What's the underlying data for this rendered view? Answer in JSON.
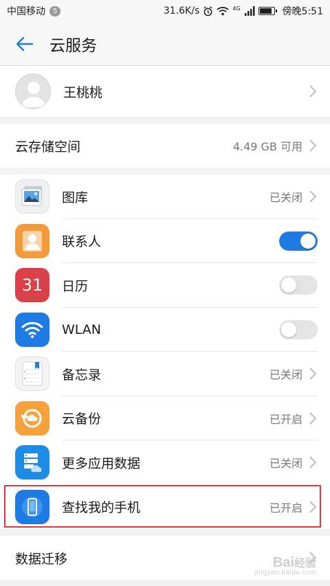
{
  "status_bar": {
    "carrier": "中国移动",
    "sim_badge": "5",
    "speed": "31.6K/s",
    "network": "4G",
    "time": "傍晚5:51"
  },
  "app_bar": {
    "title": "云服务",
    "back_icon": "arrow-left-icon"
  },
  "account": {
    "name": "王桃桃",
    "avatar_icon": "default-avatar-icon"
  },
  "storage": {
    "label": "云存储空间",
    "value": "4.49 GB 可用"
  },
  "apps": [
    {
      "label": "图库",
      "state_text": "已关闭",
      "control": "chevron",
      "icon": "gallery-icon"
    },
    {
      "label": "联系人",
      "control": "toggle",
      "toggle_on": true,
      "icon": "contacts-icon"
    },
    {
      "label": "日历",
      "control": "toggle",
      "toggle_on": false,
      "icon": "calendar-icon",
      "icon_text": "31"
    },
    {
      "label": "WLAN",
      "control": "toggle",
      "toggle_on": false,
      "icon": "wlan-icon"
    },
    {
      "label": "备忘录",
      "state_text": "已关闭",
      "control": "chevron",
      "icon": "notepad-icon"
    },
    {
      "label": "云备份",
      "state_text": "已开启",
      "control": "chevron",
      "icon": "cloud-backup-icon"
    },
    {
      "label": "更多应用数据",
      "state_text": "已关闭",
      "control": "chevron",
      "icon": "more-app-data-icon"
    },
    {
      "label": "查找我的手机",
      "state_text": "已开启",
      "control": "chevron",
      "icon": "find-phone-icon"
    }
  ],
  "migrate": {
    "label": "数据迁移"
  },
  "colors": {
    "accent": "#1e7be4",
    "highlight": "#e0343f",
    "calendar": "#d8404a",
    "contacts": "#f39a3c",
    "wlan": "#1e7be4",
    "backup": "#f5a23d",
    "more": "#1e8ce4",
    "find": "#1e7be4"
  },
  "watermark": {
    "brand": "Bai",
    "brand_cn": "经验",
    "url": "jingyan.baidu.com"
  }
}
